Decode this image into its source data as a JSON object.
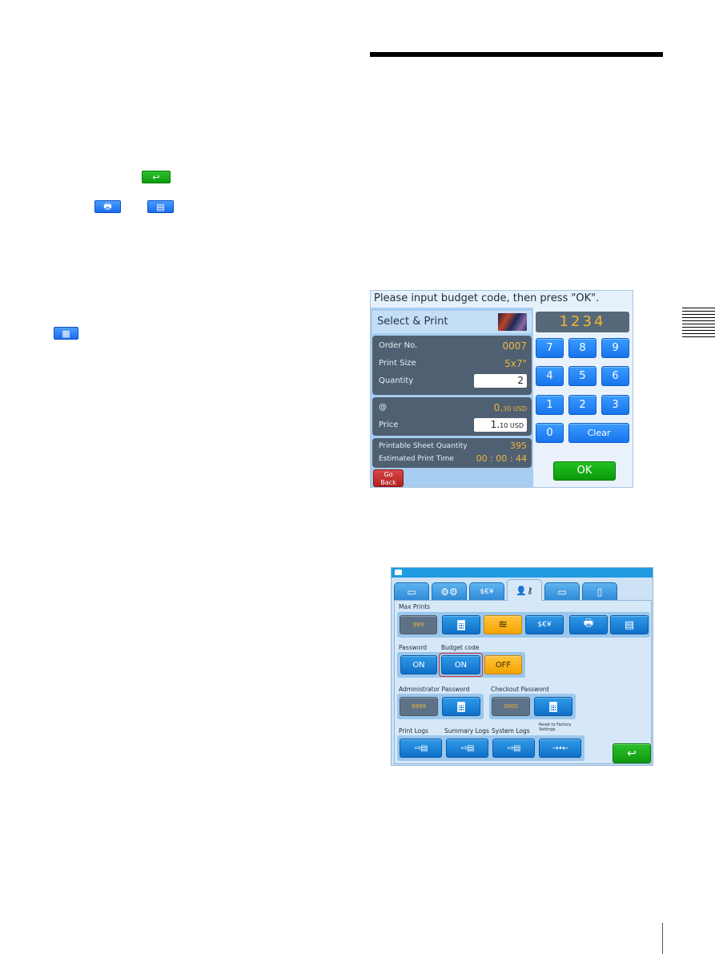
{
  "page": {
    "inline_icons": {
      "return": "return-arrow-icon",
      "printer": "printer-icon",
      "card_reader": "card-reader-icon",
      "calculator": "calculator-icon"
    }
  },
  "screen1": {
    "prompt": "Please input budget code, then press \"OK\".",
    "title": "Select & Print",
    "order": {
      "order_no_label": "Order No.",
      "order_no_value": "0007",
      "print_size_label": "Print Size",
      "print_size_value": "5x7\"",
      "quantity_label": "Quantity",
      "quantity_value": "2"
    },
    "pricing": {
      "unit_label": "@",
      "unit_int": "0.",
      "unit_dec": "30 USD",
      "price_label": "Price",
      "price_int": "1.",
      "price_dec": "10 USD"
    },
    "status": {
      "sheet_label": "Printable Sheet Quantity",
      "sheet_value": "395",
      "time_label": "Estimated Print Time",
      "time_value": "00 : 00 : 44"
    },
    "go_back_line1": "Go",
    "go_back_line2": "Back",
    "display_value": "1234",
    "keys": [
      "7",
      "8",
      "9",
      "4",
      "5",
      "6",
      "1",
      "2",
      "3",
      "0"
    ],
    "clear_label": "Clear",
    "ok_label": "OK"
  },
  "screen2": {
    "tabs": [
      {
        "icon": "display-icon",
        "glyph": "▭",
        "active": false
      },
      {
        "icon": "gears-icon",
        "glyph": "⚙⚙",
        "active": false
      },
      {
        "icon": "currency-icon",
        "glyph": "$€¥",
        "active": false
      },
      {
        "icon": "user-key-icon",
        "glyph": "👤⚷",
        "active": true
      },
      {
        "icon": "frame-icon",
        "glyph": "▭",
        "active": false
      },
      {
        "icon": "paper-icon",
        "glyph": "▯",
        "active": false
      }
    ],
    "max_prints_label": "Max Prints",
    "max_prints_value": "999",
    "password_label": "Password",
    "password_on": "ON",
    "budget_code_label": "Budget code",
    "budget_on": "ON",
    "budget_off": "OFF",
    "admin_password_label": "Administrator Password",
    "admin_password_value": "9999",
    "checkout_password_label": "Checkout Password",
    "checkout_password_value": "0000",
    "print_logs_label": "Print Logs",
    "summary_logs_label": "Summary Logs",
    "system_logs_label": "System Logs",
    "reset_label": "Reset to Factory Settings",
    "export_glyph": "⇨▤",
    "reset_glyph": "→•←",
    "return_glyph": "↩"
  }
}
